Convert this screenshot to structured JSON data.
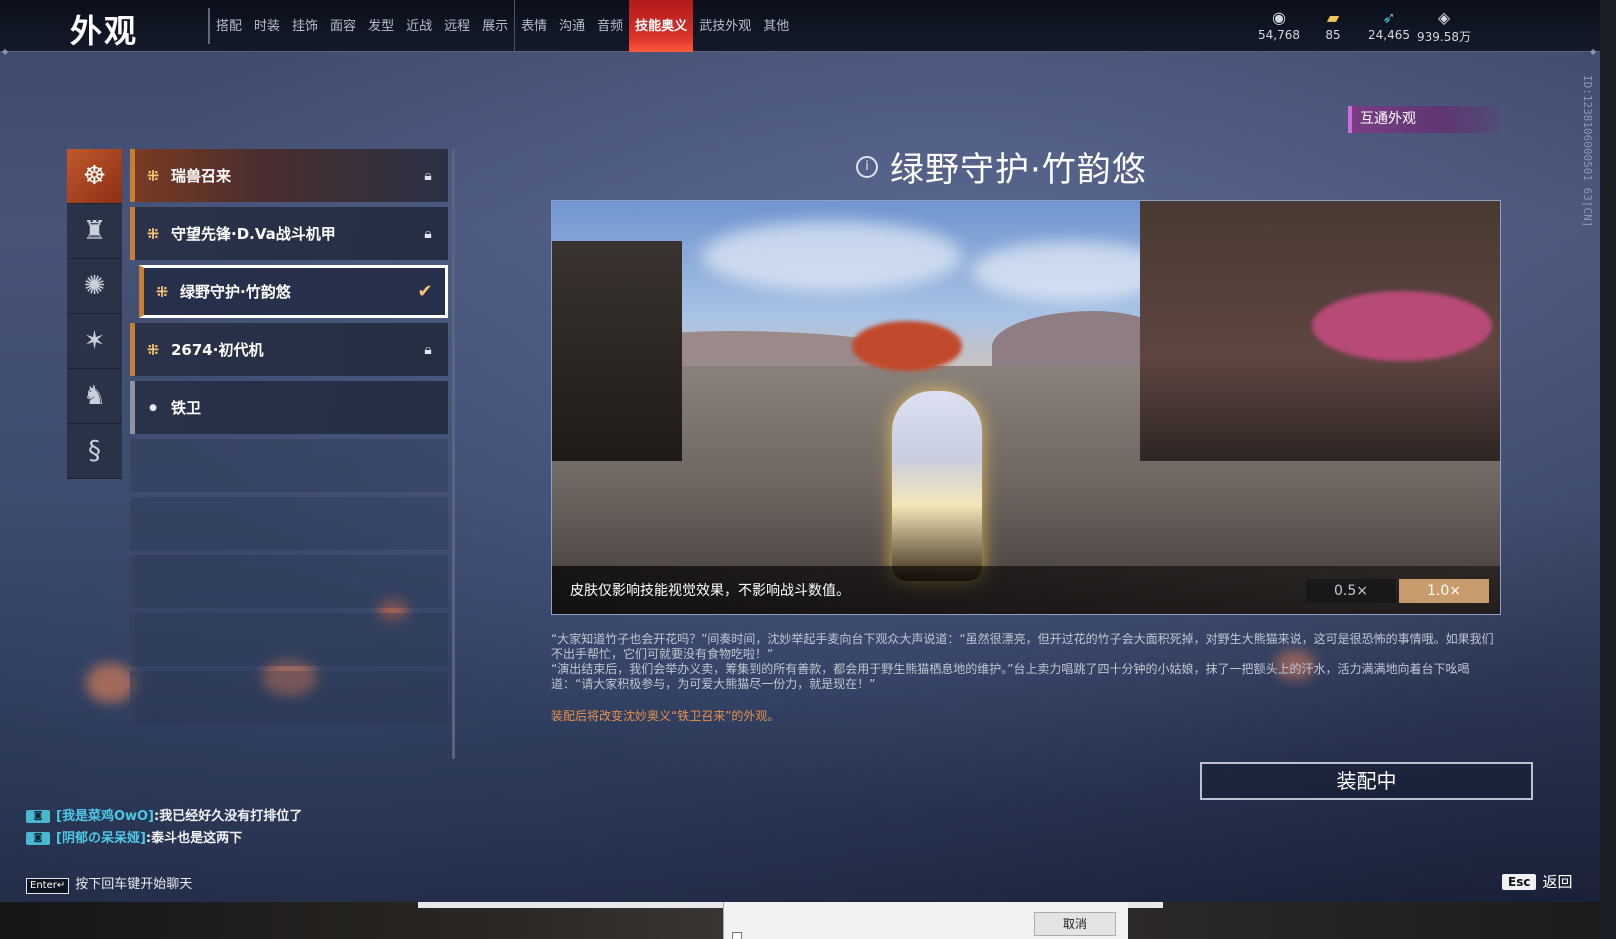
{
  "header": {
    "title": "外观",
    "tabs": [
      "搭配",
      "时装",
      "挂饰",
      "面容",
      "发型",
      "近战",
      "远程",
      "展示",
      "表情",
      "沟通",
      "音频",
      "技能奥义",
      "武技外观",
      "其他"
    ],
    "active_tab": "技能奥义",
    "currencies": [
      {
        "icon": "coin-stack-icon",
        "value": "54,768"
      },
      {
        "icon": "gold-ticket-icon",
        "value": "85"
      },
      {
        "icon": "feather-icon",
        "value": "24,465"
      },
      {
        "icon": "diamond-icon",
        "value": "939.58万"
      }
    ]
  },
  "side_id": "ID:1238106000501 63[CN]",
  "categories": [
    {
      "icon": "beast-mask-icon",
      "active": true
    },
    {
      "icon": "warrior-figure-icon",
      "active": false
    },
    {
      "icon": "lion-head-icon",
      "active": false
    },
    {
      "icon": "burst-icon",
      "active": false
    },
    {
      "icon": "rider-icon",
      "active": false
    },
    {
      "icon": "dragon-icon",
      "active": false
    }
  ],
  "skins": [
    {
      "name": "瑞兽召来",
      "status": "locked"
    },
    {
      "name": "守望先锋·D.Va战斗机甲",
      "status": "locked"
    },
    {
      "name": "绿野守护·竹韵悠",
      "status": "selected"
    },
    {
      "name": "2674·初代机",
      "status": "locked"
    },
    {
      "name": "铁卫",
      "status": "default"
    }
  ],
  "detail": {
    "badge": "互通外观",
    "title": "绿野守护·竹韵悠",
    "caption": "皮肤仅影响技能视觉效果，不影响战斗数值。",
    "speed_options": [
      "0.5×",
      "1.0×"
    ],
    "active_speed": "1.0×",
    "description": [
      "“大家知道竹子也会开花吗？”间奏时间，沈妙举起手麦向台下观众大声说道：“虽然很漂亮，但开过花的竹子会大面积死掉，对野生大熊猫来说，这可是很恐怖的事情哦。如果我们不出手帮忙，它们可就要没有食物吃啦！”",
      "“演出结束后，我们会举办义卖，筹集到的所有善款，都会用于野生熊猫栖息地的维护。”台上卖力唱跳了四十分钟的小姑娘，抹了一把额头上的汗水，活力满满地向着台下吆喝道：“请大家积极参与，为可爱大熊猫尽一份力，就是现在！”"
    ],
    "note": "装配后将改变沈妙奥义“铁卫召来”的外观。",
    "equip_button": "装配中"
  },
  "chat": {
    "lines": [
      {
        "channel_icon": "chat-channel-icon",
        "name": "[我是菜鸡OwO]",
        "message": ":我已经好久没有打排位了"
      },
      {
        "channel_icon": "chat-channel-icon",
        "name": "[阴郁の呆呆娅]",
        "message": ":泰斗也是这两下"
      }
    ],
    "enter_key": "Enter↵",
    "hint": "按下回车键开始聊天"
  },
  "footer": {
    "esc_key": "Esc",
    "back_label": "返回"
  },
  "desktop_dialog": {
    "cancel_label": "取消"
  }
}
